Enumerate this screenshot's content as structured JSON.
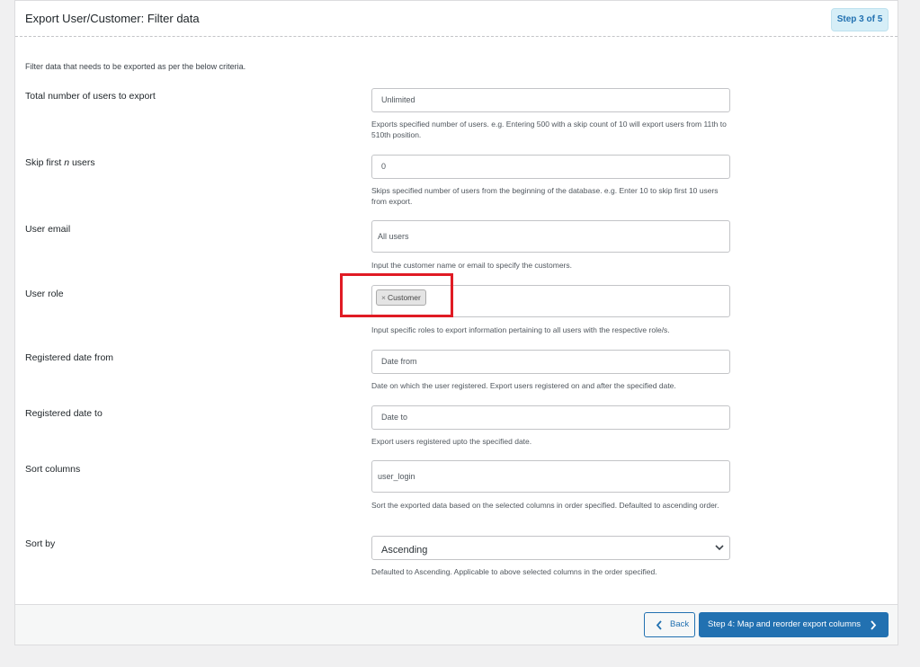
{
  "header": {
    "title": "Export User/Customer: Filter data",
    "step_badge": "Step 3 of 5"
  },
  "intro": "Filter data that needs to be exported as per the below criteria.",
  "fields": {
    "total_users": {
      "label": "Total number of users to export",
      "placeholder": "Unlimited",
      "help": "Exports specified number of users. e.g. Entering 500 with a skip count of 10 will export users from 11th to 510th position."
    },
    "skip_users": {
      "label_prefix": "Skip first ",
      "label_var": "n",
      "label_suffix": " users",
      "value": "0",
      "help": "Skips specified number of users from the beginning of the database. e.g. Enter 10 to skip first 10 users from export."
    },
    "user_email": {
      "label": "User email",
      "placeholder": "All users",
      "help": "Input the customer name or email to specify the customers."
    },
    "user_role": {
      "label": "User role",
      "tag_remove": "×",
      "tag": "Customer",
      "help": "Input specific roles to export information pertaining to all users with the respective role/s."
    },
    "date_from": {
      "label": "Registered date from",
      "placeholder": "Date from",
      "help": "Date on which the user registered. Export users registered on and after the specified date."
    },
    "date_to": {
      "label": "Registered date to",
      "placeholder": "Date to",
      "help": "Export users registered upto the specified date."
    },
    "sort_columns": {
      "label": "Sort columns",
      "value": "user_login",
      "help": "Sort the exported data based on the selected columns in order specified. Defaulted to ascending order."
    },
    "sort_by": {
      "label": "Sort by",
      "selected": "Ascending",
      "help": "Defaulted to Ascending. Applicable to above selected columns in the order specified."
    }
  },
  "footer": {
    "back_label": "Back",
    "next_label": "Step 4: Map and reorder export columns"
  },
  "colors": {
    "primary": "#2271b1",
    "highlight": "#e01b24",
    "badge_bg": "#d6eef7"
  },
  "icons": {
    "back": "chevron-left-icon",
    "next": "chevron-right-icon",
    "select": "chevron-down-icon"
  }
}
